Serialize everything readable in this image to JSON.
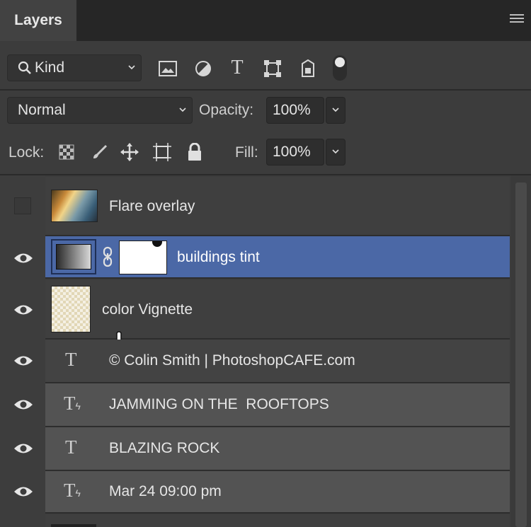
{
  "panel": {
    "tab_label": "Layers",
    "menu_icon": "hamburger-icon"
  },
  "filter": {
    "kind_label": "Kind",
    "filter_icons": [
      "image-filter-icon",
      "adjustment-filter-icon",
      "type-filter-icon",
      "shape-filter-icon",
      "smart-object-filter-icon",
      "filter-toggle-icon"
    ]
  },
  "blend": {
    "mode": "Normal",
    "opacity_label": "Opacity:",
    "opacity_value": "100%"
  },
  "lock": {
    "label": "Lock:",
    "icons": [
      "lock-transparent-pixels-icon",
      "lock-image-pixels-icon",
      "lock-position-icon",
      "lock-artboard-icon",
      "lock-all-icon"
    ],
    "fill_label": "Fill:",
    "fill_value": "100%"
  },
  "layers": [
    {
      "name": "Flare overlay",
      "visible": false,
      "type": "image",
      "selected": false
    },
    {
      "name": "buildings tint",
      "visible": true,
      "type": "adjustment-with-mask",
      "selected": true
    },
    {
      "name": "color Vignette",
      "visible": true,
      "type": "image-transparent",
      "selected": false
    },
    {
      "name": "© Colin Smith | PhotoshopCAFE.com",
      "visible": true,
      "type": "text",
      "selected": false
    },
    {
      "name": "JAMMING ON THE  ROOFTOPS",
      "visible": true,
      "type": "text-warped",
      "selected": false
    },
    {
      "name": "BLAZING ROCK",
      "visible": true,
      "type": "text",
      "selected": false
    },
    {
      "name": "Mar 24 09:00 pm",
      "visible": true,
      "type": "text-warped",
      "selected": false
    }
  ],
  "colors": {
    "selected_row": "#4b68a6",
    "panel_bg": "#3c3c3c",
    "text_row_bg": "#535353"
  }
}
